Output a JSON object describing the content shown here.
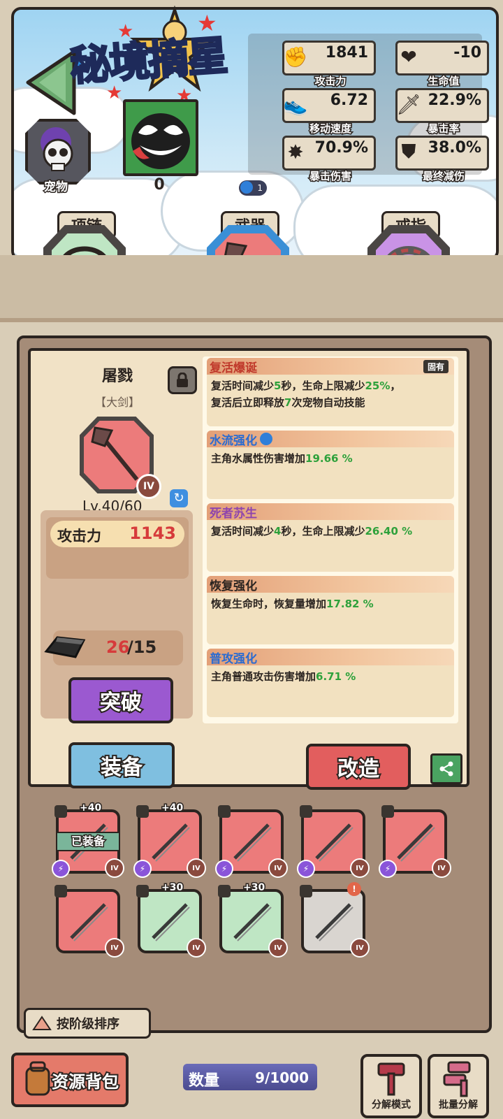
{
  "header": {
    "logo_text": "秘境摘星",
    "stats": [
      {
        "icon": "fist-icon",
        "value": "1841",
        "label": "攻击力"
      },
      {
        "icon": "heart-icon",
        "value": "-10",
        "label": "生命值"
      },
      {
        "icon": "shoe-icon",
        "value": "6.72",
        "label": "移动速度"
      },
      {
        "icon": "sword-icon",
        "value": "22.9%",
        "label": "暴击率"
      },
      {
        "icon": "explosion-icon",
        "value": "70.9%",
        "label": "暴击伤害"
      },
      {
        "icon": "shield-icon",
        "value": "38.0%",
        "label": "最终减伤"
      }
    ],
    "pet_label": "宠物",
    "character_count": "0",
    "drop_badge": "1"
  },
  "slots": [
    {
      "label": "项链",
      "color": "#bfe6c4"
    },
    {
      "label": "武器",
      "color": "#ec7b7b"
    },
    {
      "label": "戒指",
      "color": "#c993e6"
    }
  ],
  "item": {
    "name": "屠戮",
    "type": "【大剑】",
    "grade": "IV",
    "level": "Lv.40/60",
    "restore_label": "还原",
    "attack_label": "攻击力",
    "attack_value": "1143",
    "material_have": "26",
    "material_need": "/15",
    "breakthrough_label": "突破",
    "equip_label": "装备",
    "reforge_label": "改造"
  },
  "effects": [
    {
      "title": "复活爆诞",
      "tag": "固有",
      "title_color": "#c0392b",
      "lines": [
        [
          "复活时间减少",
          "5",
          "秒，生命上限减少",
          "25%",
          "，"
        ],
        [
          "复活后立即释放",
          "7",
          "次宠物自动技能"
        ]
      ]
    },
    {
      "title": "水流强化",
      "title_color": "#2a6bd1",
      "lines": [
        [
          "主角水属性伤害增加",
          "19.66 %"
        ]
      ]
    },
    {
      "title": "死者苏生",
      "title_color": "#8e44ad",
      "lines": [
        [
          "复活时间减少",
          "4",
          "秒，生命上限减少",
          "26.40 %"
        ]
      ]
    },
    {
      "title": "恢复强化",
      "title_color": "#2b2420",
      "lines": [
        [
          "恢复生命时，恢复量增加",
          "17.82 %"
        ]
      ]
    },
    {
      "title": "普攻强化",
      "title_color": "#2a6bd1",
      "lines": [
        [
          "主角普通攻击伤害增加",
          "6.71 %"
        ]
      ]
    }
  ],
  "inventory": [
    {
      "bg": "#ec7b7b",
      "plus": "+40",
      "equipped": "已装备",
      "grade": "IV",
      "bolt": true
    },
    {
      "bg": "#ec7b7b",
      "plus": "+40",
      "grade": "IV",
      "bolt": true
    },
    {
      "bg": "#ec7b7b",
      "grade": "IV",
      "bolt": true
    },
    {
      "bg": "#ec7b7b",
      "grade": "IV",
      "bolt": true
    },
    {
      "bg": "#ec7b7b",
      "grade": "IV",
      "bolt": true
    },
    {
      "bg": "#ec7b7b",
      "grade": "IV"
    },
    {
      "bg": "#bfe6c4",
      "plus": "+30",
      "grade": "IV"
    },
    {
      "bg": "#bfe6c4",
      "plus": "+30",
      "grade": "IV"
    },
    {
      "bg": "#d9d5d0",
      "grade": "IV",
      "alert": "!"
    }
  ],
  "sort_label": "按阶级排序",
  "footer": {
    "bag_label": "资源背包",
    "count_label": "数量",
    "count_value": "9/1000",
    "decompose_mode": "分解模式",
    "batch_decompose": "批量分解"
  }
}
